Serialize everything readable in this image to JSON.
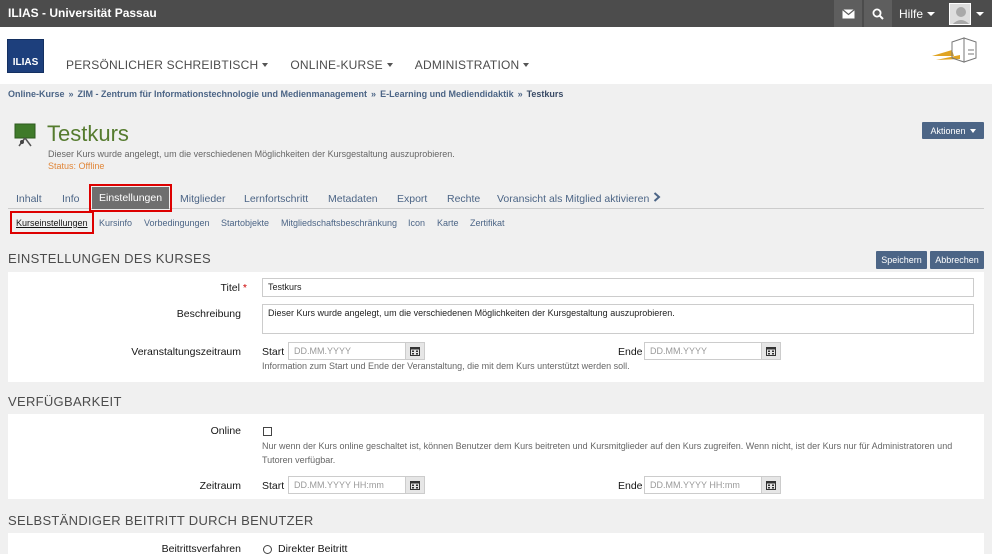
{
  "topbar": {
    "brand": "ILIAS - Universität Passau",
    "help_label": "Hilfe",
    "mail_icon": "mail-icon",
    "search_icon": "search-icon"
  },
  "header": {
    "logo_text": "ILIAS",
    "menu": [
      {
        "label": "PERSÖNLICHER SCHREIBTISCH"
      },
      {
        "label": "ONLINE-KURSE"
      },
      {
        "label": "ADMINISTRATION"
      }
    ]
  },
  "breadcrumb": [
    "Online-Kurse",
    "ZIM - Zentrum für Informationstechnologie und Medienmanagement",
    "E-Learning und Mediendidaktik",
    "Testkurs"
  ],
  "breadcrumb_sep": "»",
  "page": {
    "title": "Testkurs",
    "description": "Dieser Kurs wurde angelegt, um die verschiedenen Möglichkeiten der Kursgestaltung auszuprobieren.",
    "status": "Status: Offline",
    "actions_label": "Aktionen"
  },
  "tabs": [
    "Inhalt",
    "Info",
    "Einstellungen",
    "Mitglieder",
    "Lernfortschritt",
    "Metadaten",
    "Export",
    "Rechte",
    "Voransicht als Mitglied aktivieren"
  ],
  "active_tab": "Einstellungen",
  "subtabs": [
    "Kurseinstellungen",
    "Kursinfo",
    "Vorbedingungen",
    "Startobjekte",
    "Mitgliedschaftsbeschränkung",
    "Icon",
    "Karte",
    "Zertifikat"
  ],
  "active_subtab": "Kurseinstellungen",
  "form": {
    "section1_title": "EINSTELLUNGEN DES KURSES",
    "save_label": "Speichern",
    "cancel_label": "Abbrechen",
    "title_label": "Titel",
    "title_required": "*",
    "title_value": "Testkurs",
    "desc_label": "Beschreibung",
    "desc_value": "Dieser Kurs wurde angelegt, um die verschiedenen Möglichkeiten der Kursgestaltung auszuprobieren.",
    "period_label": "Veranstaltungszeitraum",
    "start_label": "Start",
    "end_label": "Ende",
    "date_placeholder": "DD.MM.YYYY",
    "period_info": "Information zum Start und Ende der Veranstaltung, die mit dem Kurs unterstützt werden soll.",
    "section2_title": "VERFÜGBARKEIT",
    "online_label": "Online",
    "online_info": "Nur wenn der Kurs online geschaltet ist, können Benutzer dem Kurs beitreten und Kursmitglieder auf den Kurs zugreifen. Wenn nicht, ist der Kurs nur für Administratoren und Tutoren verfügbar.",
    "zeitraum_label": "Zeitraum",
    "datetime_placeholder": "DD.MM.YYYY HH:mm",
    "section3_title": "SELBSTÄNDIGER BEITRITT DURCH BENUTZER",
    "join_label": "Beitrittsverfahren",
    "join_option": "Direkter Beitritt"
  },
  "colors": {
    "accent": "#4c6586",
    "title_green": "#557b2e",
    "status_orange": "#e08639",
    "highlight_red": "#dd0000"
  }
}
